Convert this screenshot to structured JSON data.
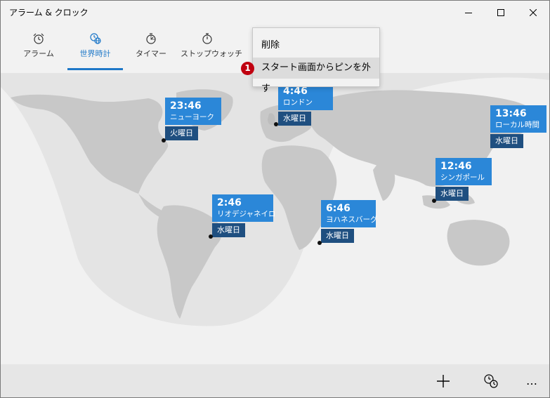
{
  "window": {
    "title": "アラーム & クロック"
  },
  "tabs": [
    {
      "label": "アラーム",
      "icon": "alarm-clock-icon"
    },
    {
      "label": "世界時計",
      "icon": "world-clock-icon"
    },
    {
      "label": "タイマー",
      "icon": "timer-icon"
    },
    {
      "label": "ストップウォッチ",
      "icon": "stopwatch-icon"
    }
  ],
  "active_tab": "世界時計",
  "context_menu": {
    "items": [
      {
        "label": "削除"
      },
      {
        "label": "スタート画面からピンを外す"
      }
    ],
    "step_badge": "1"
  },
  "cities": [
    {
      "time": "23:46",
      "name": "ニューヨーク",
      "day": "火曜日"
    },
    {
      "time": "4:46",
      "name": "ロンドン",
      "day": "水曜日"
    },
    {
      "time": "13:46",
      "name": "ローカル時間",
      "day": "水曜日"
    },
    {
      "time": "12:46",
      "name": "シンガポール",
      "day": "水曜日"
    },
    {
      "time": "2:46",
      "name": "リオデジャネイロ",
      "day": "水曜日"
    },
    {
      "time": "6:46",
      "name": "ヨハネスバーグ",
      "day": "水曜日"
    }
  ],
  "bottom_bar": {
    "buttons": [
      "add-icon",
      "compare-clock-icon",
      "more-icon"
    ],
    "more_label": "…"
  },
  "colors": {
    "accent": "#1e78c8",
    "card": "#2b87d8",
    "day_badge": "#1f4f80",
    "badge": "#c00010"
  }
}
